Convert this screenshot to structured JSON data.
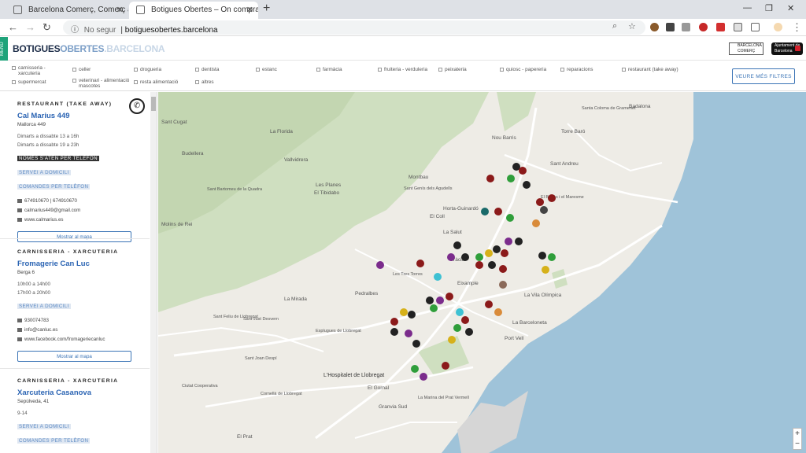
{
  "browser": {
    "tabs": [
      {
        "title": "Barcelona Comerç, Comerç a Bar",
        "active": false
      },
      {
        "title": "Botigues Obertes – On comprar a",
        "active": true
      }
    ],
    "insecure_label": "No segur",
    "url": "botiguesobertes.barcelona"
  },
  "site": {
    "menu_label": "MENÚ",
    "logo": {
      "part1": "BOTIGUES",
      "part2": "OBERTES",
      "part3": ".BARCELONA"
    },
    "partners": [
      "BARCELONA COMERÇ",
      "Ajuntament de Barcelona"
    ]
  },
  "filters": {
    "items": [
      "carnisseria - xarcuteria",
      "celler",
      "drogueria",
      "dentista",
      "estanc",
      "farmàcia",
      "fruiteria - verduleria",
      "peixateria",
      "quiosc - papereria",
      "reparacions",
      "restaurant (take away)",
      "supermercat",
      "veterinari - alimentació mascotes",
      "resta alimentació",
      "altres"
    ],
    "more_label": "VEURE MÉS FILTRES"
  },
  "listings": [
    {
      "category": "RESTAURANT (TAKE AWAY)",
      "name": "Cal Marius 449",
      "address": "Mallorca 449",
      "hours": [
        "Dimarts a dissabte 13 a 16h",
        "Dimarts a dissabte 19 a 23h"
      ],
      "tags_dark": [
        "NOMÉS S'ATEN PER TELÈFON"
      ],
      "tags_light": [
        "SERVEI A DOMICILI",
        "COMANDES PER TELÈFON"
      ],
      "phone": "674910670 | 674910670",
      "email": "calmarius449@gmail.com",
      "web": "www.calmarius.es",
      "map_button": "Mostrar al mapa"
    },
    {
      "category": "CARNISSERIA - XARCUTERIA",
      "name": "Fromagerie Can Luc",
      "address": "Berga 6",
      "hours": [
        "10h00 a 14h00",
        "17h00 a 20h00"
      ],
      "tags_light": [
        "SERVEI A DOMICILI"
      ],
      "phone": "930074783",
      "email": "info@canluc.es",
      "web": "www.facebook.com/fromageriecanluc",
      "map_button": "Mostrar al mapa"
    },
    {
      "category": "CARNISSERIA - XARCUTERIA",
      "name": "Xarcuteria Casanova",
      "address": "Sepúlveda, 41",
      "hours": [
        "9-14"
      ],
      "tags_light": [
        "SERVEI A DOMICILI",
        "COMANDES PER TELÈFON"
      ]
    }
  ],
  "map": {
    "labels": [
      "Badalona",
      "Santa Coloma de Gramenet",
      "El Besòs i el Maresme",
      "Sant Andreu",
      "Nou Barris",
      "Horta-Guinardó",
      "Montbau",
      "Sant Genís dels Agudells",
      "El Coll",
      "La Salut",
      "Gràcia",
      "Eixample",
      "Les Tres Torres",
      "Pedralbes",
      "Sant Just Desvern",
      "Esplugues de Llobregat",
      "L'Hospitalet de Llobregat",
      "El Gornal",
      "La Marina del Prat Vermell",
      "Granvia Sud",
      "La Barceloneta",
      "La Vila Olímpica",
      "Sant Feliu de Llobregat",
      "Sant Joan Despí",
      "Cornellà de Llobregat",
      "Sant Cugat",
      "La Florida",
      "Vallvidrera",
      "Sant Bartomeu de la Quadra",
      "Molins de Rei",
      "Budellera",
      "Torre Baró",
      "Ciutat Cooperativa",
      "El Prat",
      "Port Vell",
      "La Mirada",
      "El Tibidabo",
      "Les Planes"
    ],
    "zoom_in": "+",
    "zoom_out": "−",
    "colors": {
      "land": "#eeece6",
      "park": "#cfdfc0",
      "sea": "#9fc3d9",
      "road": "#ffffff",
      "pin_dark": "#222222",
      "pin_red": "#8b1a1a",
      "pin_green": "#2f9e3a",
      "pin_purple": "#7b2c8c"
    }
  }
}
